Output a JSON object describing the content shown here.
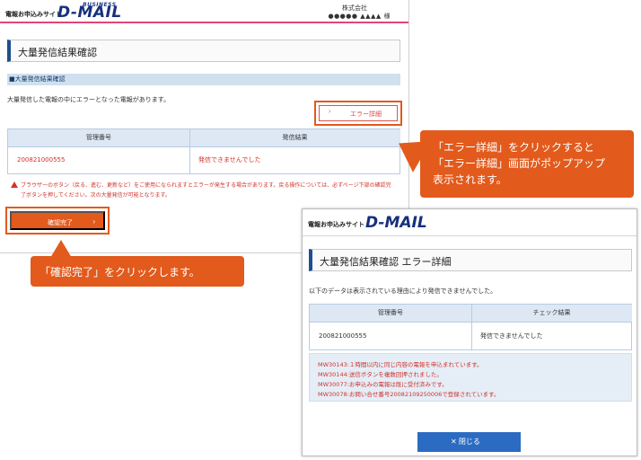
{
  "main_window": {
    "header": {
      "service_name": "電報お申込みサイト",
      "logo_business": "BUSINESS",
      "logo_text": "D-MAIL",
      "company_label": "株式会社",
      "user_label": "●●●●● ▲▲▲▲ 様"
    },
    "page_title": "大量発信結果確認",
    "section_title": "■大量発信結果確認",
    "message": "大量発信した電報の中にエラーとなった電報があります。",
    "error_detail_button": {
      "chevron": "›",
      "label": "エラー詳細"
    },
    "table": {
      "headers": [
        "管理番号",
        "発信結果"
      ],
      "rows": [
        {
          "id": "200821000555",
          "result": "発信できませんでした"
        }
      ]
    },
    "warning": {
      "line1": "ブラウザーのボタン（戻る、進む、更新など）をご使用になられますとエラーが発生する場合があります。戻る操作については、必ずページ下部の確認完",
      "line2": "了ボタンを押してください。次の大量発信が可能となります。"
    },
    "confirm_button": {
      "label": "確認完了",
      "chevron": "›"
    }
  },
  "callouts": {
    "error_detail": {
      "line1": "「エラー詳細」をクリックすると",
      "line2": "「エラー詳細」画面がポップアップ",
      "line3": "表示されます。"
    },
    "confirm": {
      "text": "「確認完了」をクリックします。"
    }
  },
  "popup": {
    "service_name": "電報お申込みサイト",
    "logo_text": "D-MAIL",
    "title": "大量発信結果確認 エラー詳細",
    "message": "以下のデータは表示されている理由により発信できませんでした。",
    "table": {
      "headers": [
        "管理番号",
        "チェック結果"
      ],
      "rows": [
        {
          "id": "200821000555",
          "result": "発信できませんでした"
        }
      ]
    },
    "errors": [
      "MW30143:１時間以内に同じ内容の電報を申込まれています。",
      "MW30144:送信ボタンを複数回押されました。",
      "MW30077:お申込みの電報は既に受付済みです。",
      "MW30078:お問い合せ番号20082109250006で登録されています。"
    ],
    "close_button": {
      "label": "✕ 閉じる"
    }
  },
  "colors": {
    "accent_orange": "#e25a1c",
    "brand_navy": "#17307d",
    "header_pink": "#e0457b",
    "error_red": "#d0322a",
    "table_header": "#dde8f4",
    "close_button": "#2c6bc2"
  }
}
